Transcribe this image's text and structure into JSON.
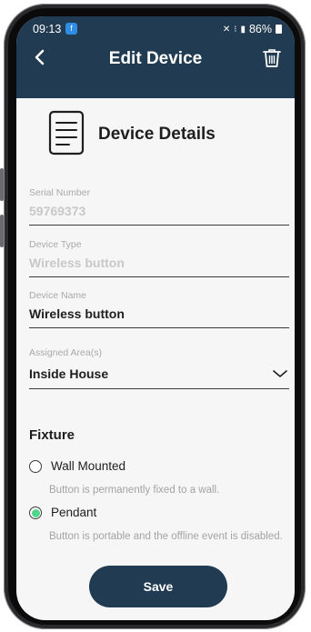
{
  "status_bar": {
    "time": "09:13",
    "battery": "86%",
    "app_notification_icon": "facebook-icon",
    "icons": [
      "mute-icon",
      "wifi-icon",
      "signal-icon"
    ]
  },
  "header": {
    "title": "Edit Device",
    "back_icon": "chevron-left-icon",
    "delete_icon": "trash-icon"
  },
  "section": {
    "title": "Device Details",
    "icon": "document-icon"
  },
  "fields": {
    "serial": {
      "label": "Serial Number",
      "value": "59769373"
    },
    "type": {
      "label": "Device Type",
      "value": "Wireless button"
    },
    "name": {
      "label": "Device Name",
      "value": "Wireless button"
    },
    "area": {
      "label": "Assigned Area(s)",
      "value": "Inside House"
    }
  },
  "fixture": {
    "title": "Fixture",
    "options": [
      {
        "label": "Wall Mounted",
        "description": "Button is permanently fixed to a wall.",
        "selected": false
      },
      {
        "label": "Pendant",
        "description": "Button is portable and the offline event is disabled.",
        "selected": true
      }
    ]
  },
  "actions": {
    "save_label": "Save"
  },
  "colors": {
    "header_bg": "#213b52",
    "radio_selected": "#4fd68b",
    "screen_bg": "#f6f6f6"
  }
}
